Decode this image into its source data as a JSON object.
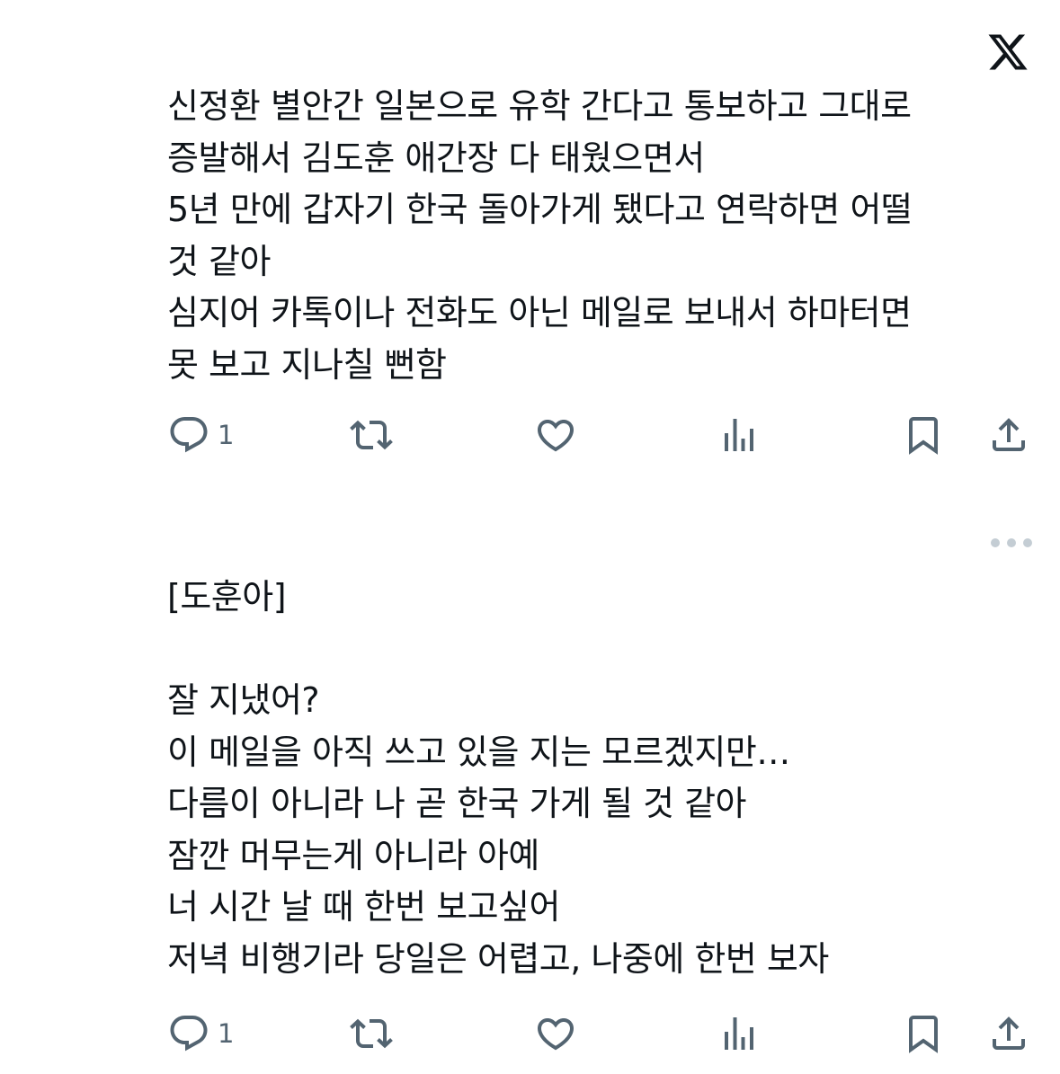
{
  "header": {
    "logo_icon": "x-logo-icon"
  },
  "tweets": [
    {
      "lines": [
        "신정환 별안간 일본으로 유학 간다고 통보하고 그대로",
        "증발해서 김도훈 애간장 다 태웠으면서",
        "5년 만에 갑자기 한국 돌아가게 됐다고 연락하면 어떨",
        "것 같아",
        "심지어 카톡이나 전화도 아닌 메일로 보내서 하마터면",
        "못 보고 지나칠 뻔함"
      ],
      "reply_count": "1"
    },
    {
      "lines": [
        "[도훈아]",
        "",
        "잘 지냈어?",
        "이 메일을 아직 쓰고 있을 지는 모르겠지만…",
        "다름이 아니라 나 곧 한국 가게 될 것 같아",
        "잠깐 머무는게 아니라 아예",
        "너 시간 날 때 한번 보고싶어",
        "저녁 비행기라 당일은 어렵고, 나중에 한번 보자"
      ],
      "reply_count": "1"
    }
  ],
  "action_icons": [
    "reply-icon",
    "retweet-icon",
    "like-icon",
    "views-icon",
    "bookmark-icon",
    "share-icon"
  ],
  "more_icon": "more-icon",
  "colors": {
    "text": "#0f1419",
    "icon": "#536471",
    "dots": "#c4cdd4"
  }
}
